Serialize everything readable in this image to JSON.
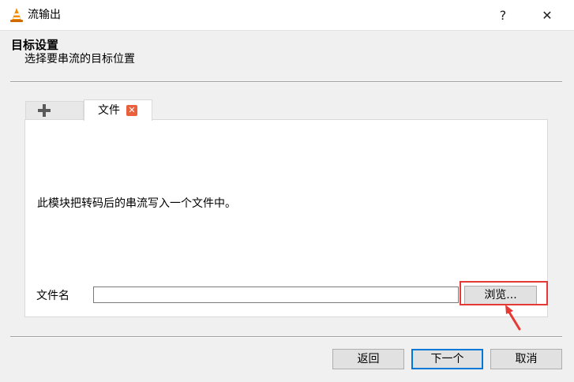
{
  "window": {
    "title": "流输出",
    "help_label": "?",
    "close_label": "✕",
    "app_icon": "vlc-cone-icon"
  },
  "header": {
    "title": "目标设置",
    "subtitle": "选择要串流的目标位置"
  },
  "tabs": [
    {
      "label": "",
      "icon": "plus-icon"
    },
    {
      "label": "文件",
      "close_icon": "close-tab-icon"
    }
  ],
  "panel": {
    "description": "此模块把转码后的串流写入一个文件中。",
    "filename_label": "文件名",
    "filename_value": "",
    "browse_label": "浏览..."
  },
  "footer": {
    "back_label": "返回",
    "next_label": "下一个",
    "cancel_label": "取消"
  },
  "colors": {
    "highlight": "#e53935",
    "tab_close": "#e8603c",
    "default_button_border": "#0078d7"
  }
}
